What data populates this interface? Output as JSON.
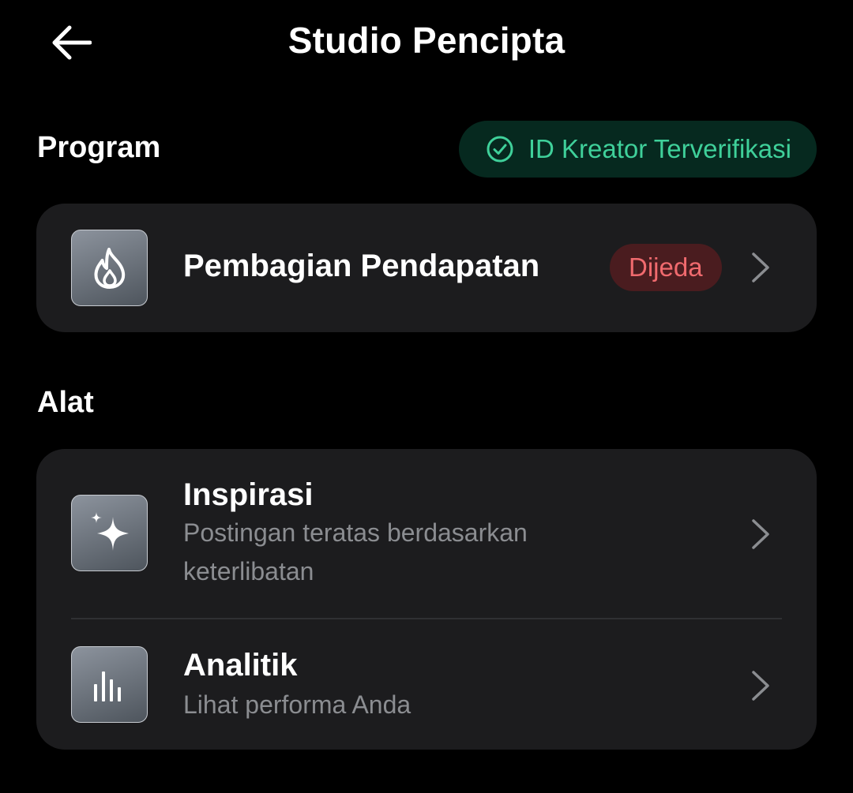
{
  "header": {
    "title": "Studio Pencipta",
    "back_icon": "arrow-left-icon"
  },
  "program": {
    "section_title": "Program",
    "verified_badge": {
      "label": "ID Kreator Terverifikasi",
      "icon": "check-circle-icon",
      "color": "#3fd09a",
      "background": "#06291f"
    },
    "items": [
      {
        "title": "Pembagian Pendapatan",
        "icon": "flame-icon",
        "status": "Dijeda",
        "status_color": "#f06a6e",
        "status_background": "#4a1c1f"
      }
    ]
  },
  "tools": {
    "section_title": "Alat",
    "items": [
      {
        "title": "Inspirasi",
        "subtitle": "Postingan teratas berdasarkan keterlibatan",
        "icon": "sparkle-icon"
      },
      {
        "title": "Analitik",
        "subtitle": "Lihat performa Anda",
        "icon": "bar-chart-icon"
      }
    ]
  },
  "colors": {
    "background": "#000000",
    "card": "#1c1c1e",
    "subtitle": "#8b8d91"
  }
}
